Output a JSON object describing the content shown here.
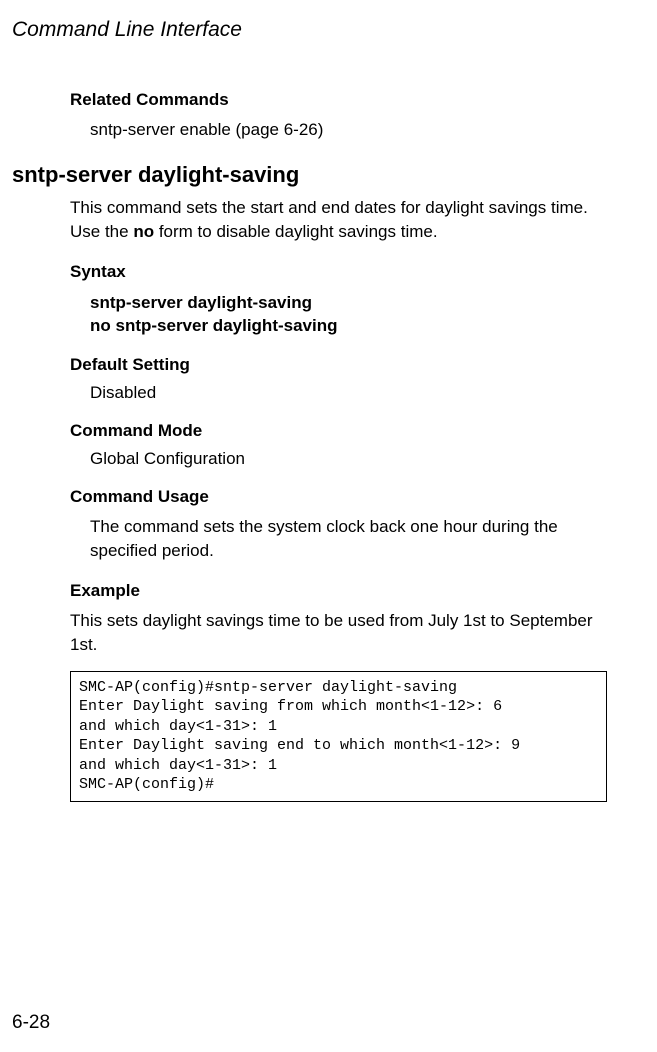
{
  "header": {
    "title": "Command Line Interface"
  },
  "related": {
    "heading": "Related Commands",
    "item": "sntp-server enable (page 6-26)"
  },
  "section": {
    "heading": "sntp-server daylight-saving",
    "description_pre": "This command sets the start and end dates for daylight savings time. Use the ",
    "description_bold": "no",
    "description_post": " form to disable daylight savings time."
  },
  "syntax": {
    "heading": "Syntax",
    "line1": "sntp-server daylight-saving",
    "line2": "no sntp-server daylight-saving"
  },
  "default": {
    "heading": "Default Setting",
    "value": "Disabled"
  },
  "mode": {
    "heading": "Command Mode",
    "value": "Global Configuration"
  },
  "usage": {
    "heading": "Command Usage",
    "text": "The command sets the system clock back one hour during the specified period."
  },
  "example": {
    "heading": "Example",
    "text": "This sets daylight savings time to be used from July 1st to September 1st.",
    "code": "SMC-AP(config)#sntp-server daylight-saving\nEnter Daylight saving from which month<1-12>: 6\nand which day<1-31>: 1\nEnter Daylight saving end to which month<1-12>: 9\nand which day<1-31>: 1\nSMC-AP(config)#"
  },
  "footer": {
    "page": "6-28"
  }
}
